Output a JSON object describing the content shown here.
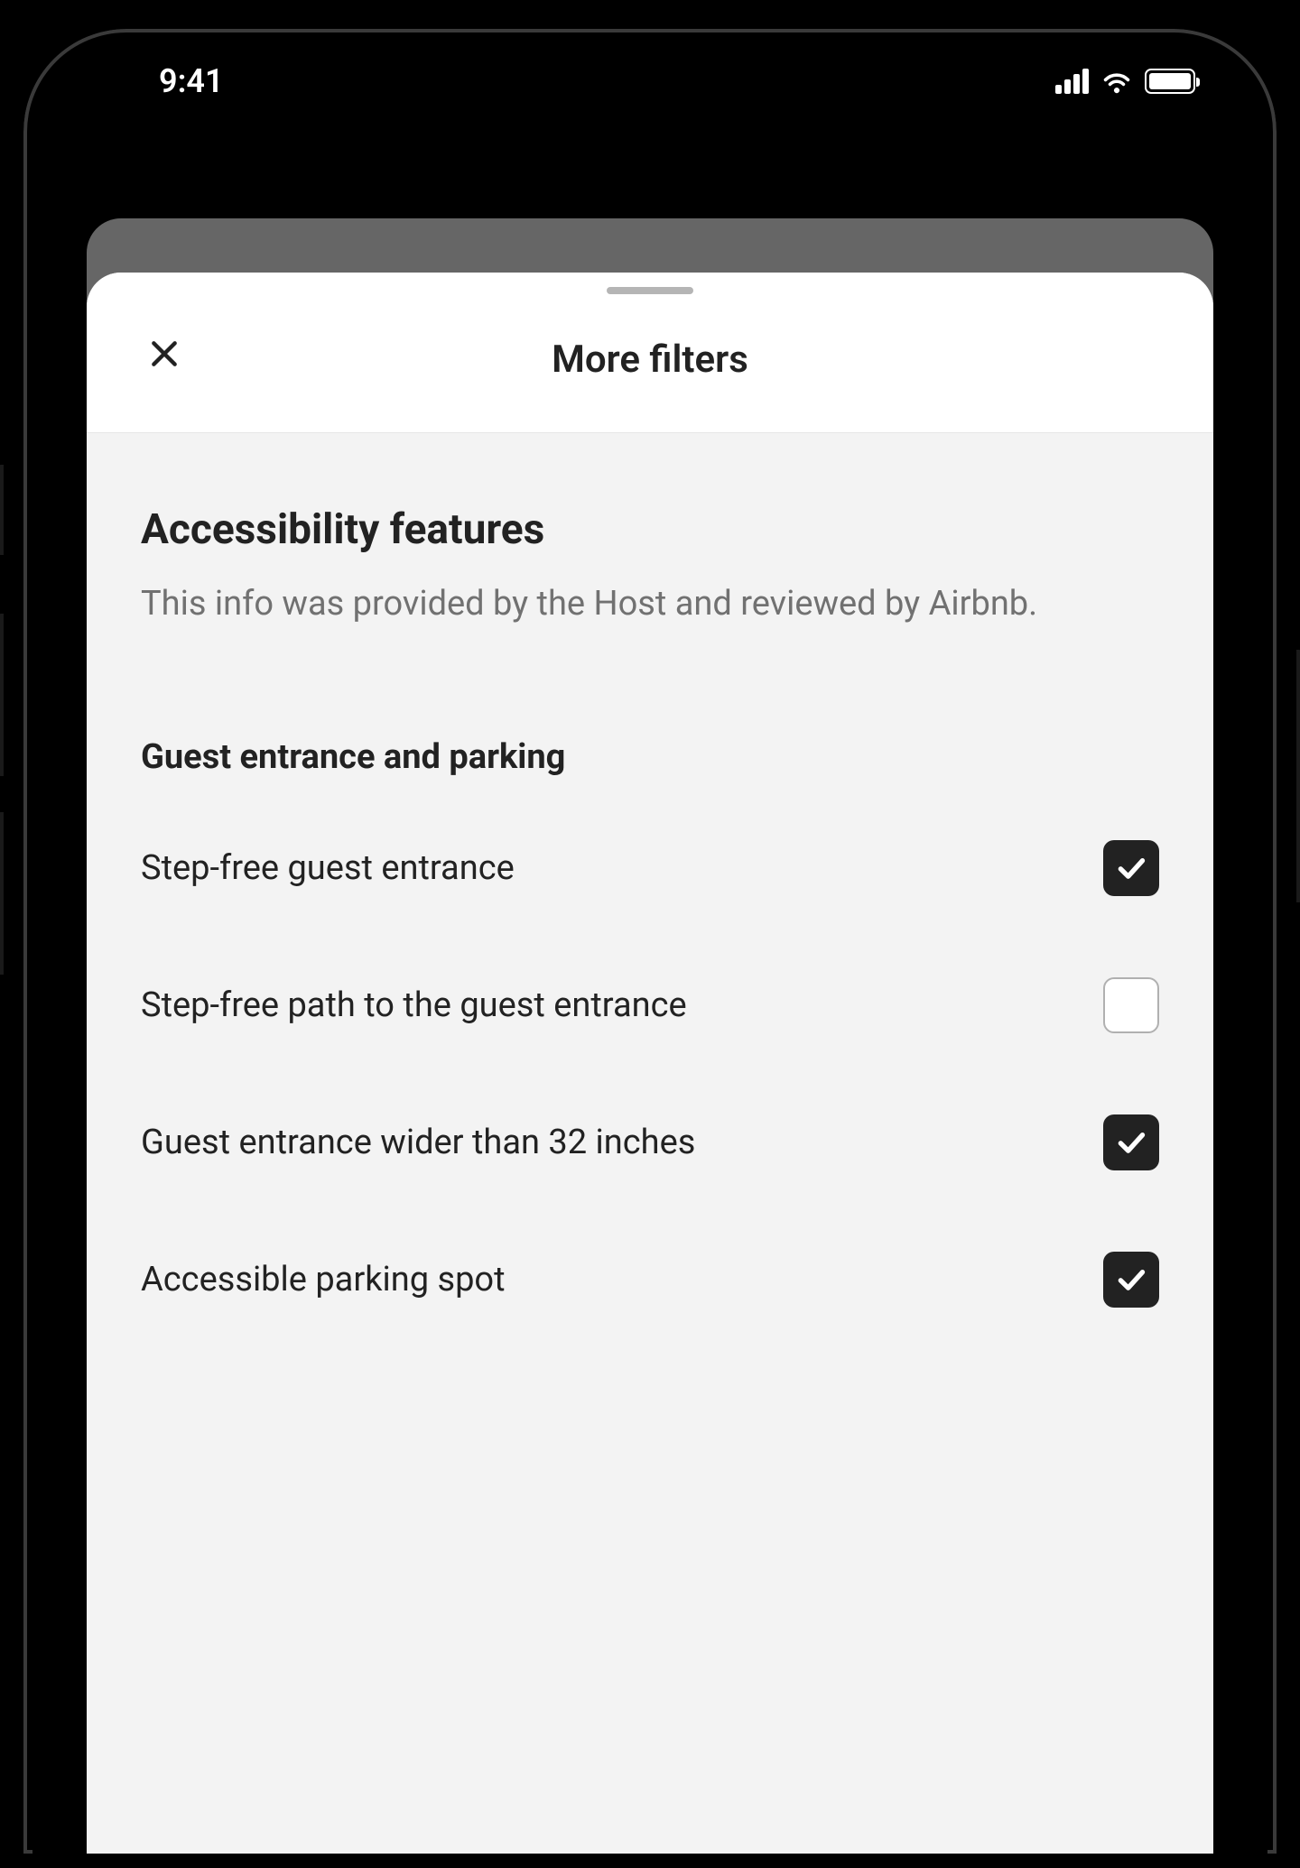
{
  "status": {
    "time": "9:41"
  },
  "modal": {
    "title": "More filters",
    "section": {
      "heading": "Accessibility features",
      "description": "This info was provided by the Host and reviewed by Airbnb."
    },
    "group": {
      "title": "Guest entrance and parking",
      "options": [
        {
          "label": "Step-free guest entrance",
          "checked": true
        },
        {
          "label": "Step-free path to the guest entrance",
          "checked": false
        },
        {
          "label": "Guest entrance wider than 32 inches",
          "checked": true
        },
        {
          "label": "Accessible parking spot",
          "checked": true
        }
      ]
    }
  }
}
